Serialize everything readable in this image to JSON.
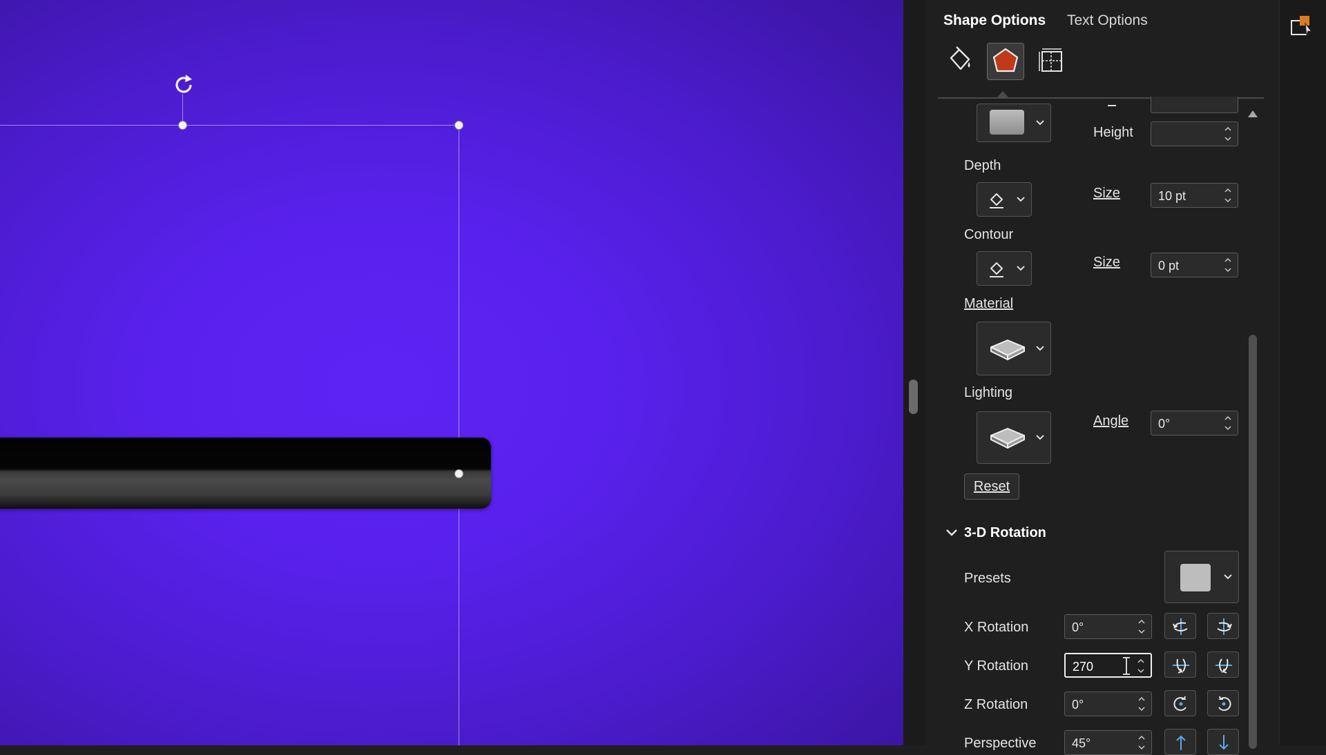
{
  "pane": {
    "tabs": [
      {
        "label": "Shape Options",
        "active": true
      },
      {
        "label": "Text Options",
        "active": false
      }
    ],
    "category_icons": [
      "fill-line-icon",
      "effects-pentagon-icon",
      "size-properties-icon"
    ],
    "accent_color": "#c0391b"
  },
  "format_3d": {
    "cut_off_field": {
      "value": ""
    },
    "height": {
      "label": "Height",
      "value": ""
    },
    "depth": {
      "label": "Depth",
      "size_label": "Size",
      "size_value": "10 pt"
    },
    "contour": {
      "label": "Contour",
      "size_label": "Size",
      "size_value": "0 pt"
    },
    "material": {
      "label": "Material"
    },
    "lighting": {
      "label": "Lighting",
      "angle_label": "Angle",
      "angle_value": "0°"
    },
    "reset_label": "Reset"
  },
  "rotation_3d": {
    "section_title": "3-D Rotation",
    "presets_label": "Presets",
    "x_rotation": {
      "label": "X Rotation",
      "value": "0°"
    },
    "y_rotation": {
      "label": "Y Rotation",
      "value": "270"
    },
    "z_rotation": {
      "label": "Z Rotation",
      "value": "0°"
    },
    "perspective": {
      "label": "Perspective",
      "value": "45°"
    }
  },
  "canvas": {
    "background_color": "#5a21ee",
    "shape_color": "#000000"
  }
}
